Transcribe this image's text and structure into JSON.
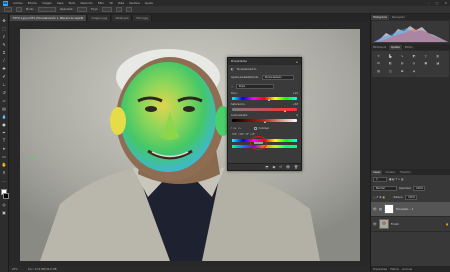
{
  "menubar": {
    "logo": "Ps",
    "items": [
      "Archivo",
      "Edición",
      "Imagen",
      "Capa",
      "Texto",
      "Selección",
      "Filtro",
      "3D",
      "Vista",
      "Ventana",
      "Ayuda"
    ]
  },
  "options": {
    "labels": [
      "Modo:",
      "Opacidad:",
      "Flujo:"
    ]
  },
  "tabs": [
    {
      "label": "FOTO-1.jpg al 25% (Tono/saturación 1, Máscara de capa/8)"
    },
    {
      "label": "imagen-2.jpg"
    },
    {
      "label": "retrato.psd"
    },
    {
      "label": "foto-4.jpg"
    }
  ],
  "props": {
    "title": "Propiedades",
    "subtitle": "Tono/saturación",
    "preset_label": "Ajuste preestablecido:",
    "preset_value": "Personalizado",
    "channel_value": "Rojos",
    "hue_label": "Tono:",
    "hue_value": "+21",
    "sat_label": "Saturación:",
    "sat_value": "+63",
    "light_label": "Luminosidad:",
    "light_value": "0",
    "colorize": "Colorear",
    "range_values": "315° / 345°   15° \\ 45°"
  },
  "status": {
    "zoom": "25%",
    "doc": "Doc: 24,9 MB/49,8 MB"
  },
  "right": {
    "histogram_tabs": [
      "Histograma",
      "Navegador"
    ],
    "adjust_tabs": [
      "Bibliotecas",
      "Ajustes",
      "Estilos"
    ],
    "layers_tabs": [
      "Capas",
      "Canales",
      "Trazados"
    ],
    "blend": "Normal",
    "opacity_label": "Opacidad:",
    "opacity_value": "100%",
    "fill_label": "Relleno:",
    "fill_value": "100%",
    "layer1": "Tono/satu... 1",
    "layer2": "Fondo",
    "bottom": [
      "Propiedades",
      "Historia",
      "Acciones"
    ]
  },
  "colors": {
    "ps_blue": "#31a8ff",
    "highlight": "#e81010",
    "skin_yellow": "#e6e04a",
    "skin_green": "#4cd65a",
    "skin_cyan": "#37c7d8"
  }
}
